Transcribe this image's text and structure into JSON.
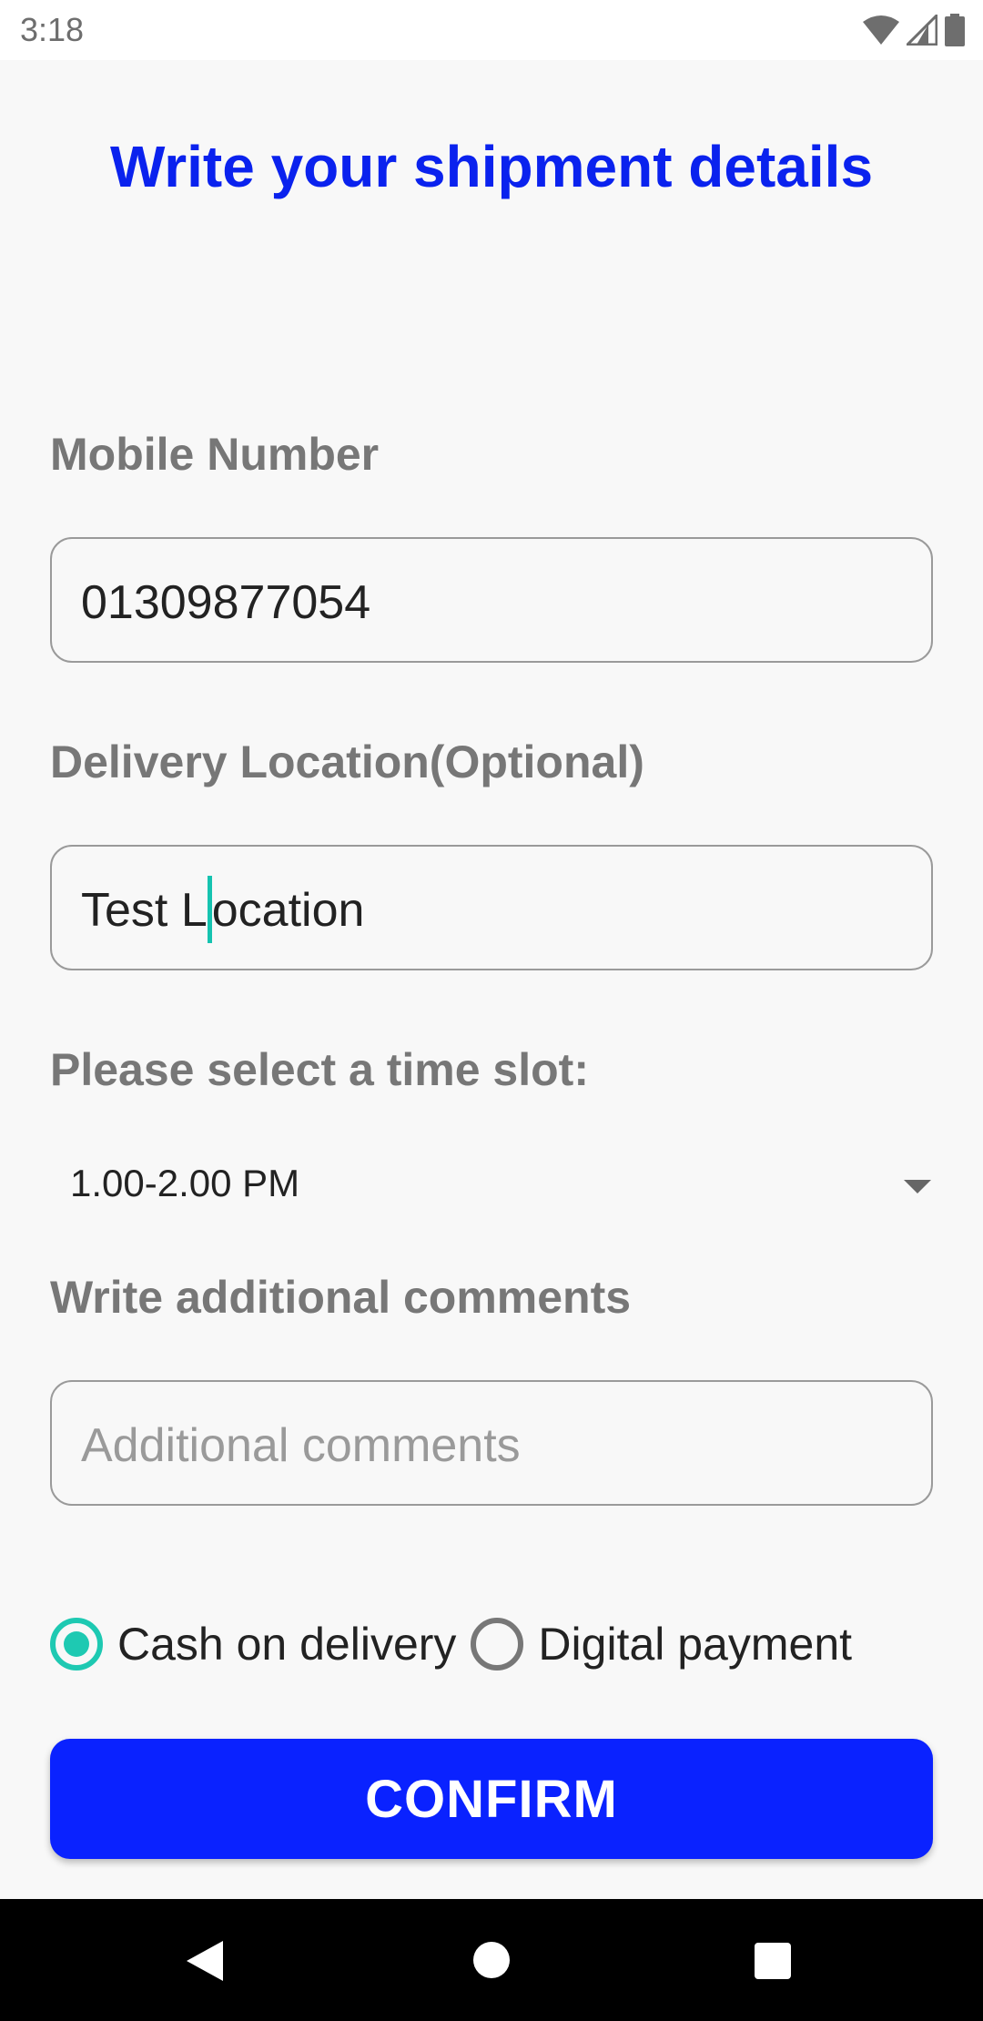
{
  "status_bar": {
    "time": "3:18",
    "icons": [
      "wifi-icon",
      "signal-icon",
      "battery-icon"
    ]
  },
  "page": {
    "title": "Write your shipment details",
    "title_color": "#0a22ee"
  },
  "form": {
    "mobile": {
      "label": "Mobile Number",
      "value": "01309877054"
    },
    "location": {
      "label": "Delivery Location(Optional)",
      "value_before_cursor": "Test L",
      "value_after_cursor": "ocation"
    },
    "time_slot": {
      "label": "Please select a time slot:",
      "selected": "1.00-2.00 PM"
    },
    "comments": {
      "label": "Write additional comments",
      "placeholder": "Additional comments",
      "value": ""
    },
    "payment": {
      "options": [
        {
          "label": "Cash on delivery",
          "checked": true
        },
        {
          "label": "Digital payment",
          "checked": false
        }
      ],
      "accent_color": "#1ec9b2"
    },
    "confirm_label": "CONFIRM",
    "confirm_color": "#0a22ff"
  },
  "nav_bar": {
    "icons": [
      "back-icon",
      "home-icon",
      "recents-icon"
    ]
  }
}
